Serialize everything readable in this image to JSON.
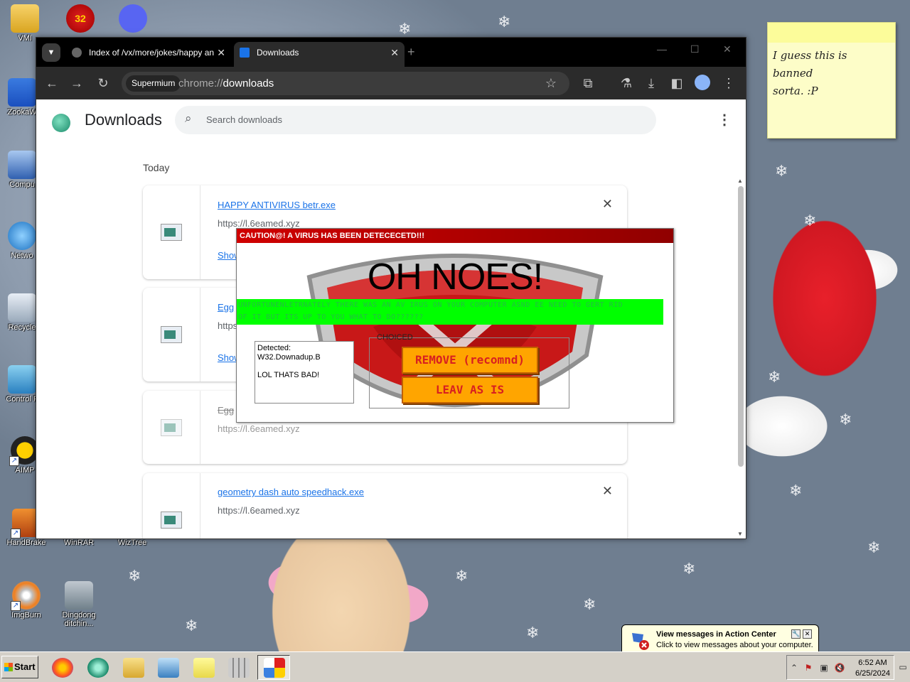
{
  "desktop": {
    "icons": [
      {
        "label": "VMI"
      },
      {
        "label": "32"
      },
      {
        "label": ""
      },
      {
        "label": "ZookaW"
      },
      {
        "label": "Compu"
      },
      {
        "label": "Netwo"
      },
      {
        "label": "Recycle"
      },
      {
        "label": "Control F"
      },
      {
        "label": "AIMP"
      },
      {
        "label": "HandBrake"
      },
      {
        "label": "WinRAR"
      },
      {
        "label": "WizTree"
      },
      {
        "label": "ImgBurn"
      },
      {
        "label": "Dingdong ditchin..."
      }
    ]
  },
  "browser": {
    "tabs": [
      {
        "title": "Index of /vx/more/jokes/happy an",
        "close": "✕"
      },
      {
        "title": "Downloads",
        "close": "✕"
      }
    ],
    "new_tab": "+",
    "window_controls": {
      "minimize": "—",
      "maximize": "☐",
      "close": "✕"
    },
    "profile_chip": "Supermium",
    "url_scheme": "chrome://",
    "url_path": "downloads"
  },
  "downloads_page": {
    "title": "Downloads",
    "search_placeholder": "Search downloads",
    "section": "Today",
    "items": [
      {
        "name": "HAPPY ANTIVIRUS betr.exe",
        "url": "https://l.6eamed.xyz",
        "show": "Show in folder",
        "removed": false
      },
      {
        "name": "Egg",
        "url": "https://l.6eamed.xyz",
        "show": "Show in folder",
        "removed": false
      },
      {
        "name": "Egg",
        "url": "https://l.6eamed.xyz",
        "show": "",
        "removed": true
      },
      {
        "name": "geometry dash auto speedhack.exe",
        "url": "https://l.6eamed.xyz",
        "show": "",
        "removed": false
      }
    ]
  },
  "popup": {
    "title": "CAUTION@! A VIRUS HAS BEEN DETECECETD!!!",
    "heading": "OH NOES!",
    "message_line1": "UNFORTUNENLETRNATELY THERE WAS AN AV IRUS ON YOUR COMPUTER ASND EE NEED TO GERT RID",
    "message_line2": "OF IT BUT ITS UP TO YOU WHAT TO DO??????",
    "detected_label": "Detected:",
    "detected_name": "W32.Downadup.B",
    "detected_comment": "LOL THATS BAD!",
    "choice_legend": "CHOICED",
    "remove_button": "REMOVE (recomnd)",
    "leave_button": "LEAV AS IS"
  },
  "sticky_note": {
    "line1": "I guess this is banned",
    "line2": "sorta. :P"
  },
  "balloon": {
    "title": "View messages in Action Center",
    "text": "Click to view messages about your computer."
  },
  "taskbar": {
    "start_label": "Start",
    "time": "6:52 AM",
    "date": "6/25/2024"
  },
  "colors": {
    "popup_title_red": "#d00000",
    "popup_green_bar": "#00ff00",
    "popup_button_orange": "#ffa500",
    "link_blue": "#1a73e8"
  }
}
